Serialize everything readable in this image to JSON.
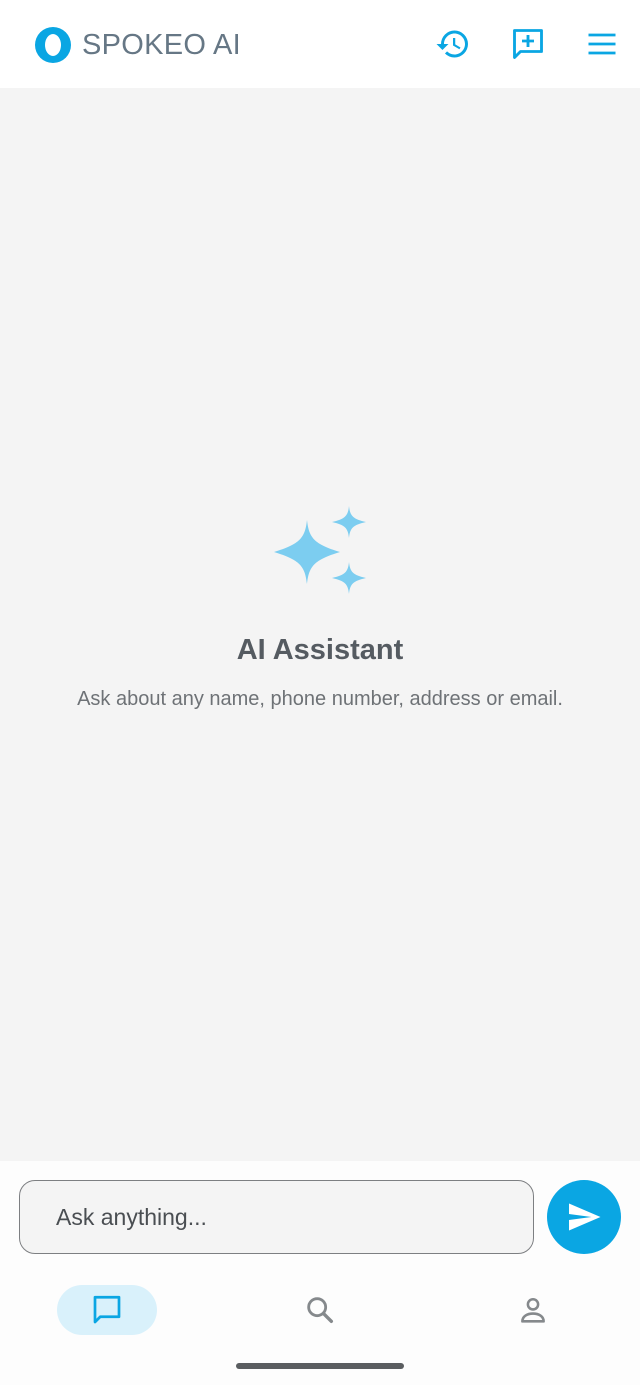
{
  "header": {
    "brand": "SPOKEO AI",
    "logo_icon": "spokeo-logo-icon",
    "actions": [
      {
        "icon": "history-icon",
        "label": "History"
      },
      {
        "icon": "new-chat-icon",
        "label": "New chat"
      },
      {
        "icon": "menu-icon",
        "label": "Menu"
      }
    ]
  },
  "main": {
    "icon": "sparkle-icon",
    "title": "AI Assistant",
    "subtitle": "Ask about any name, phone number, address or email."
  },
  "composer": {
    "placeholder": "Ask anything...",
    "value": "",
    "send_icon": "send-icon"
  },
  "bottom_nav": {
    "items": [
      {
        "icon": "chat-icon",
        "active": true
      },
      {
        "icon": "search-icon",
        "active": false
      },
      {
        "icon": "person-icon",
        "active": false
      }
    ]
  },
  "colors": {
    "accent": "#0aa6e3",
    "sparkle": "#7ccdf0",
    "brand_text": "#667785",
    "background": "#f4f4f4"
  }
}
